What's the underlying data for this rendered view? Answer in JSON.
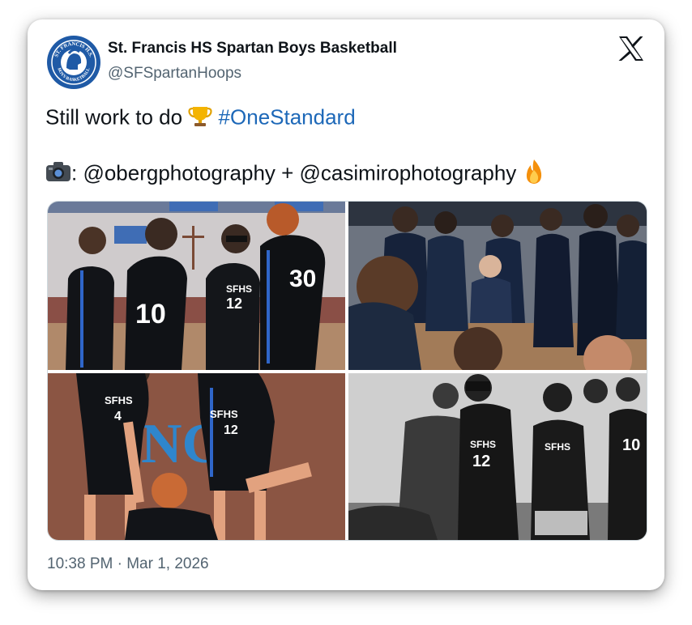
{
  "tweet": {
    "author": {
      "display_name": "St. Francis HS Spartan Boys Basketball",
      "handle": "@SFSpartanHoops",
      "avatar_icon": "spartan-logo-icon",
      "avatar_text_top": "ST. FRANCIS H.S.",
      "avatar_text_bottom": "BOYS BASKETBALL"
    },
    "brand_icon": "x-logo-icon",
    "text_line1": "Still work to do",
    "hashtag": "#OneStandard",
    "trophy_icon": "trophy-emoji-icon",
    "camera_icon": "camera-emoji-icon",
    "fire_icon": "fire-emoji-icon",
    "text_line2": ": @obergphotography + @casimirophotography",
    "photos": [
      {
        "label": "Players huddle before game",
        "jerseys": [
          "10",
          "12",
          "30"
        ]
      },
      {
        "label": "Team gathered around coach",
        "jerseys": []
      },
      {
        "label": "Teammates helping player up",
        "jerseys": [
          "4",
          "12"
        ],
        "wall_text": "NGE"
      },
      {
        "label": "Team celebrating, black and white",
        "jerseys": [
          "12",
          "10"
        ]
      }
    ],
    "jersey_text": "SFHS",
    "timestamp": "10:38 PM · Mar 1, 2026",
    "colors": {
      "hashtag": "#1d68b8",
      "secondary_text": "#536471",
      "team_blue": "#1f5aa6"
    }
  }
}
